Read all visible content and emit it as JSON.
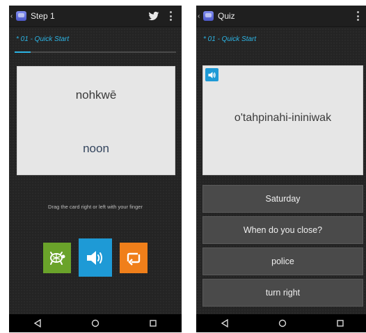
{
  "screens": {
    "step": {
      "back_caret": "‹",
      "title": "Step 1",
      "lesson_label": "* 01 - Quick Start",
      "progress": 0.1,
      "card": {
        "native": "nohkwē",
        "english": "noon"
      },
      "hint": "Drag the card right or left with your finger",
      "buttons": [
        {
          "icon": "turtle-icon",
          "color": "#6aa32a"
        },
        {
          "icon": "speaker-icon",
          "color": "#1e9ad6"
        },
        {
          "icon": "repeat-icon",
          "color": "#f07f1a"
        }
      ]
    },
    "quiz": {
      "back_caret": "‹",
      "title": "Quiz",
      "lesson_label": "* 01 - Quick Start",
      "prompt": "o'tahpinahi-ininiwak",
      "answers": [
        {
          "label": "Saturday"
        },
        {
          "label": "When do you close?"
        },
        {
          "label": "police"
        },
        {
          "label": "turn right"
        }
      ]
    }
  },
  "colors": {
    "accent": "#2cb4e4",
    "background": "#242424",
    "card": "#e6e6e6",
    "answer_bg": "#4a4a4a"
  }
}
